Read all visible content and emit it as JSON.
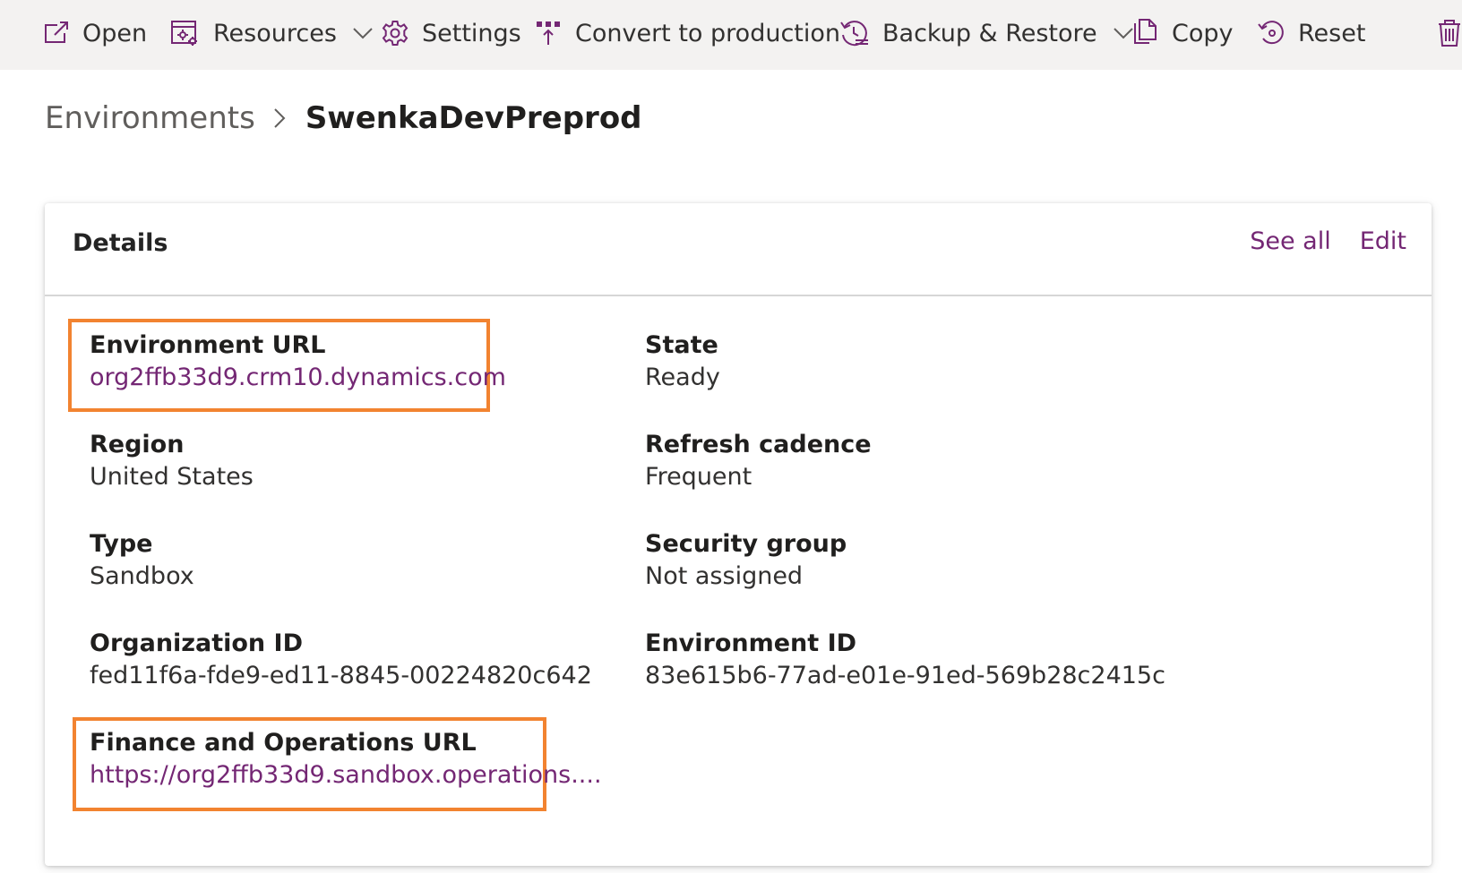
{
  "toolbar": {
    "open": "Open",
    "resources": "Resources",
    "settings": "Settings",
    "convert": "Convert to production",
    "backup": "Backup & Restore",
    "copy": "Copy",
    "reset": "Reset"
  },
  "breadcrumb": {
    "parent": "Environments",
    "current": "SwenkaDevPreprod"
  },
  "details": {
    "title": "Details",
    "see_all": "See all",
    "edit": "Edit",
    "environment_url": {
      "label": "Environment URL",
      "value": "org2ffb33d9.crm10.dynamics.com"
    },
    "state": {
      "label": "State",
      "value": "Ready"
    },
    "region": {
      "label": "Region",
      "value": "United States"
    },
    "refresh_cadence": {
      "label": "Refresh cadence",
      "value": "Frequent"
    },
    "type": {
      "label": "Type",
      "value": "Sandbox"
    },
    "security_group": {
      "label": "Security group",
      "value": "Not assigned"
    },
    "organization_id": {
      "label": "Organization ID",
      "value": "fed11f6a-fde9-ed11-8845-00224820c642"
    },
    "environment_id": {
      "label": "Environment ID",
      "value": "83e615b6-77ad-e01e-91ed-569b28c2415c"
    },
    "fo_url": {
      "label": "Finance and Operations URL",
      "value": "https://org2ffb33d9.sandbox.operations...."
    }
  },
  "colors": {
    "accent": "#742774",
    "highlight": "#f28330",
    "toolbar_bg": "#f3f2f1"
  },
  "icons": {
    "open": "open-external-icon",
    "resources": "resources-icon",
    "settings": "gear-icon",
    "convert": "convert-icon",
    "backup": "history-icon",
    "copy": "copy-icon",
    "reset": "reset-icon",
    "delete": "trash-icon"
  }
}
